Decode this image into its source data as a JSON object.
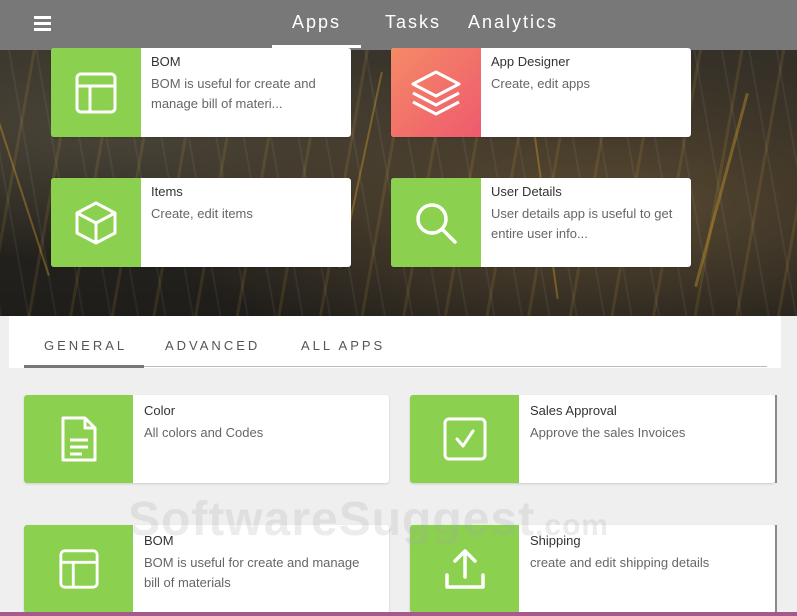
{
  "nav": {
    "tabs": [
      {
        "label": "Apps",
        "active": true
      },
      {
        "label": "Tasks",
        "active": false
      },
      {
        "label": "Analytics",
        "active": false
      }
    ]
  },
  "featured": [
    {
      "title": "BOM",
      "desc": "BOM is useful for create and manage bill of materi...",
      "icon": "layout-icon",
      "color": "#8bd04e"
    },
    {
      "title": "App Designer",
      "desc": "Create, edit apps",
      "icon": "layers-icon",
      "color": "#f0646e"
    },
    {
      "title": "Items",
      "desc": "Create, edit items",
      "icon": "cube-icon",
      "color": "#8bd04e"
    },
    {
      "title": "User Details",
      "desc": "User details app is useful to get entire user info...",
      "icon": "search-icon",
      "color": "#8bd04e"
    }
  ],
  "categories": {
    "tabs": [
      {
        "label": "GENERAL",
        "active": true
      },
      {
        "label": "ADVANCED",
        "active": false
      },
      {
        "label": "ALL APPS",
        "active": false
      }
    ]
  },
  "apps": [
    {
      "title": "Color",
      "desc": "All colors and Codes",
      "icon": "document-icon"
    },
    {
      "title": "Sales Approval",
      "desc": "Approve the sales Invoices",
      "icon": "checkbox-icon"
    },
    {
      "title": "BOM",
      "desc": "BOM is useful for create and manage bill of materials",
      "icon": "layout-icon"
    },
    {
      "title": "Shipping",
      "desc": "create and edit shipping details",
      "icon": "upload-icon"
    }
  ],
  "watermark": {
    "brand": "SoftwareSuggest",
    "suffix": ".com"
  },
  "colors": {
    "accent_green": "#8bd04e",
    "topbar": "#787878"
  }
}
